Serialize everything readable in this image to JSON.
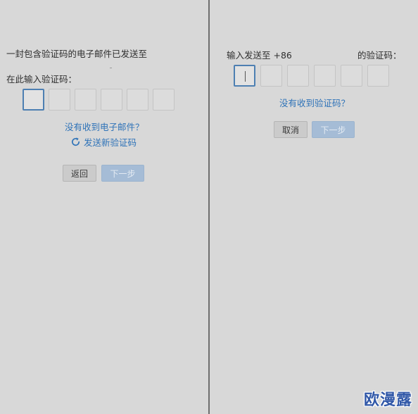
{
  "left": {
    "email_sent_text": "一封包含验证码的电子邮件已发送至",
    "enter_code_label": "在此输入验证码：",
    "no_email_link": "没有收到电子邮件？",
    "resend_link": "发送新验证码",
    "back_button": "返回",
    "next_button": "下一步",
    "code_digits": [
      "",
      "",
      "",
      "",
      "",
      ""
    ]
  },
  "right": {
    "sent_to_prefix": "输入发送至 +86",
    "sent_to_suffix": "的验证码：",
    "no_code_link": "没有收到验证码？",
    "cancel_button": "取消",
    "next_button": "下一步",
    "code_digits": [
      "",
      "",
      "",
      "",
      "",
      ""
    ]
  },
  "watermark": "欧漫露",
  "colors": {
    "link": "#2f73b8",
    "active_border": "#4d7fb2",
    "disabled_primary": "#a5bcd6",
    "background": "#d8d8d8"
  }
}
